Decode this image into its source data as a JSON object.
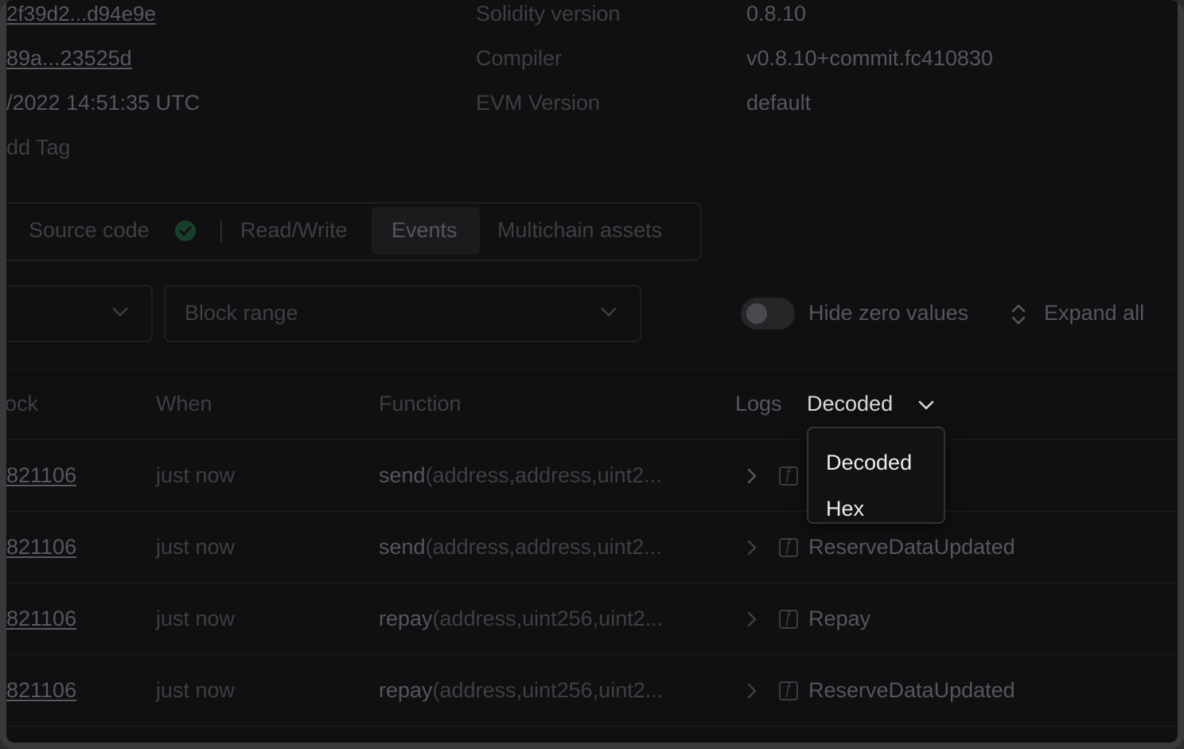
{
  "meta": {
    "left": [
      {
        "value": "2f39d2...d94e9e",
        "link": true
      },
      {
        "value": "89a...23525d",
        "link": true
      },
      {
        "value": "/2022 14:51:35 UTC",
        "link": false
      },
      {
        "value": "dd Tag",
        "link": false
      }
    ],
    "labels": [
      "Solidity version",
      "Compiler",
      "EVM Version"
    ],
    "values": [
      "0.8.10",
      "v0.8.10+commit.fc410830",
      "default"
    ]
  },
  "tabs": {
    "source_code": "Source code",
    "read_write": "Read/Write",
    "events": "Events",
    "multichain": "Multichain assets",
    "active": "Events"
  },
  "filters": {
    "block_range_placeholder": "Block range",
    "hide_zero_values": "Hide zero values",
    "hide_zero_values_on": false,
    "expand_all": "Expand all"
  },
  "table": {
    "headers": {
      "block": "ock",
      "when": "When",
      "function": "Function",
      "logs": "Logs"
    },
    "logs_mode": "Decoded",
    "rows": [
      {
        "block": "821106",
        "when": "just now",
        "fn_name": "send",
        "fn_args": "(address,address,uint2...",
        "event": ""
      },
      {
        "block": "821106",
        "when": "just now",
        "fn_name": "send",
        "fn_args": "(address,address,uint2...",
        "event": "ReserveDataUpdated"
      },
      {
        "block": "821106",
        "when": "just now",
        "fn_name": "repay",
        "fn_args": "(address,uint256,uint2...",
        "event": "Repay"
      },
      {
        "block": "821106",
        "when": "just now",
        "fn_name": "repay",
        "fn_args": "(address,uint256,uint2...",
        "event": "ReserveDataUpdated"
      }
    ]
  },
  "dropdown": {
    "options": [
      "Decoded",
      "Hex"
    ]
  },
  "colors": {
    "background": "#101012",
    "frame": "#3a3a3d",
    "menu_text": "#ececec",
    "success_check": "#2b9d5c"
  }
}
